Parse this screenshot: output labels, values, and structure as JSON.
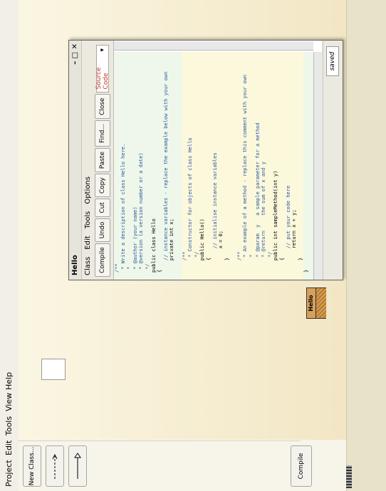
{
  "menubar": {
    "items": [
      "Project",
      "Edit",
      "Tools",
      "View",
      "Help"
    ]
  },
  "toolpanel": {
    "new_class": "New Class...",
    "compile": "Compile"
  },
  "diagram": {
    "class_name": "Hello"
  },
  "editor": {
    "title": "Hello",
    "menu": [
      "Class",
      "Edit",
      "Tools",
      "Options"
    ],
    "toolbar": [
      "Compile",
      "Undo",
      "Cut",
      "Copy",
      "Paste",
      "Find...",
      "Close"
    ],
    "view_select": "Source Code",
    "status": "saved",
    "code_lines": [
      "/**",
      " * Write a description of class Hello here.",
      " *",
      " * @author (your name)",
      " * @version (a version number or a date)",
      " */",
      "public class Hello",
      "{",
      "    // instance variables - replace the example below with your own",
      "    private int x;",
      "",
      "    /**",
      "     * Constructor for objects of class Hello",
      "     */",
      "    public Hello()",
      "    {",
      "        // initialise instance variables",
      "        x = 0;",
      "    }",
      "",
      "    /**",
      "     * An example of a method - replace this comment with your own",
      "     *",
      "     * @param  y   a sample parameter for a method",
      "     * @return     the sum of x and y",
      "     */",
      "    public int sampleMethod(int y)",
      "    {",
      "        // put your code here",
      "        return x + y;",
      "    }",
      "}"
    ]
  }
}
